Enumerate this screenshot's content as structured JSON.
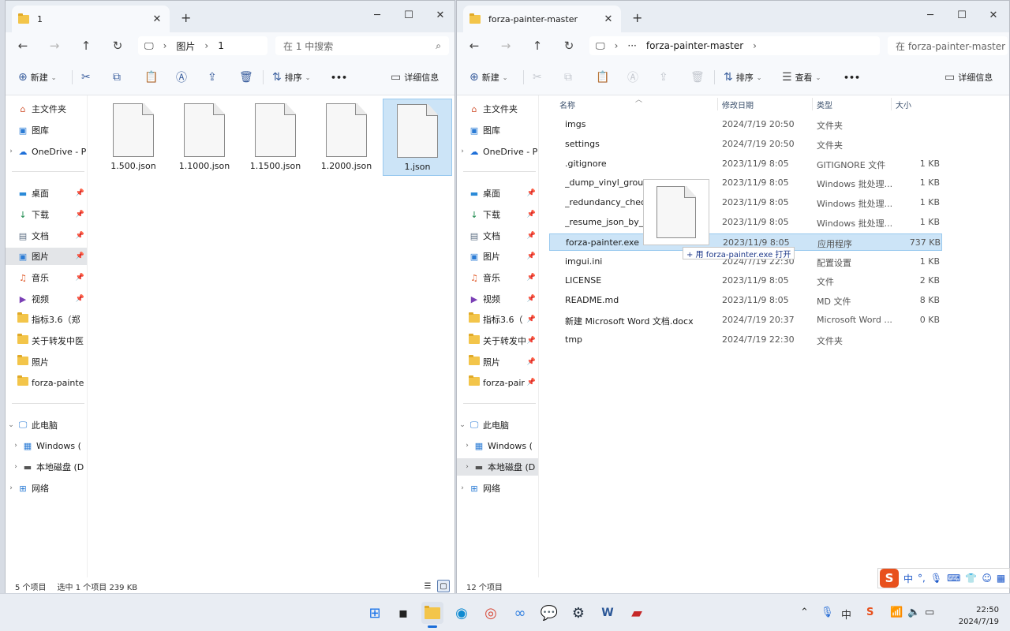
{
  "left_window": {
    "tab_title": "1",
    "address": {
      "root_label": "图片",
      "current": "1"
    },
    "search_placeholder": "在 1 中搜索",
    "toolbar": {
      "new_label": "新建",
      "sort_label": "排序",
      "details_label": "详细信息",
      "more_label": "•••"
    },
    "nav": {
      "home": "主文件夹",
      "gallery": "图库",
      "onedrive": "OneDrive - P",
      "quick": [
        {
          "label": "桌面",
          "icon": "desktop-icon"
        },
        {
          "label": "下载",
          "icon": "download-icon"
        },
        {
          "label": "文档",
          "icon": "document-icon"
        },
        {
          "label": "图片",
          "icon": "pictures-icon"
        },
        {
          "label": "音乐",
          "icon": "music-icon"
        },
        {
          "label": "视频",
          "icon": "video-icon"
        },
        {
          "label": "指标3.6（郑",
          "icon": "folder-icon"
        },
        {
          "label": "关于转发中医",
          "icon": "folder-icon"
        },
        {
          "label": "照片",
          "icon": "folder-icon"
        },
        {
          "label": "forza-painte",
          "icon": "folder-icon"
        }
      ],
      "this_pc": "此电脑",
      "drives": [
        "Windows (",
        "本地磁盘 (D"
      ],
      "network": "网络"
    },
    "files": [
      "1.500.json",
      "1.1000.json",
      "1.1500.json",
      "1.2000.json",
      "1.json"
    ],
    "selected_file": "1.json",
    "status": {
      "count": "5 个项目",
      "selection": "选中 1 个项目  239 KB"
    }
  },
  "right_window": {
    "tab_title": "forza-painter-master",
    "address": {
      "ellipsis": "···",
      "current": "forza-painter-master"
    },
    "search_placeholder": "在 forza-painter-master 中搜",
    "toolbar": {
      "new_label": "新建",
      "sort_label": "排序",
      "view_label": "查看",
      "details_label": "详细信息",
      "more_label": "•••"
    },
    "nav": {
      "home": "主文件夹",
      "gallery": "图库",
      "onedrive": "OneDrive - P",
      "quick": [
        {
          "label": "桌面",
          "icon": "desktop-icon"
        },
        {
          "label": "下载",
          "icon": "download-icon"
        },
        {
          "label": "文档",
          "icon": "document-icon"
        },
        {
          "label": "图片",
          "icon": "pictures-icon"
        },
        {
          "label": "音乐",
          "icon": "music-icon"
        },
        {
          "label": "视频",
          "icon": "video-icon"
        },
        {
          "label": "指标3.6（",
          "icon": "folder-icon"
        },
        {
          "label": "关于转发中",
          "icon": "folder-icon"
        },
        {
          "label": "照片",
          "icon": "folder-icon"
        },
        {
          "label": "forza-pair",
          "icon": "folder-icon"
        }
      ],
      "this_pc": "此电脑",
      "drives": [
        "Windows (",
        "本地磁盘 (D"
      ],
      "network": "网络"
    },
    "columns": {
      "name": "名称",
      "date": "修改日期",
      "type": "类型",
      "size": "大小"
    },
    "rows": [
      {
        "name": "imgs",
        "date": "2024/7/19 20:50",
        "type": "文件夹",
        "size": "",
        "icon": "folder"
      },
      {
        "name": "settings",
        "date": "2024/7/19 20:50",
        "type": "文件夹",
        "size": "",
        "icon": "folder"
      },
      {
        "name": ".gitignore",
        "date": "2023/11/9 8:05",
        "type": "GITIGNORE 文件",
        "size": "1 KB",
        "icon": "file"
      },
      {
        "name": "_dump_vinyl_group_",
        "date": "2023/11/9 8:05",
        "type": "Windows 批处理...",
        "size": "1 KB",
        "icon": "bat"
      },
      {
        "name": "_redundancy_check_",
        "date": "2023/11/9 8:05",
        "type": "Windows 批处理...",
        "size": "1 KB",
        "icon": "bat"
      },
      {
        "name": "_resume_json_by_dr",
        "date": "2023/11/9 8:05",
        "type": "Windows 批处理...",
        "size": "1 KB",
        "icon": "bat"
      },
      {
        "name": "forza-painter.exe",
        "date": "2023/11/9 8:05",
        "type": "应用程序",
        "size": "737 KB",
        "icon": "exe"
      },
      {
        "name": "imgui.ini",
        "date": "2024/7/19 22:30",
        "type": "配置设置",
        "size": "1 KB",
        "icon": "file"
      },
      {
        "name": "LICENSE",
        "date": "2023/11/9 8:05",
        "type": "文件",
        "size": "2 KB",
        "icon": "file"
      },
      {
        "name": "README.md",
        "date": "2023/11/9 8:05",
        "type": "MD 文件",
        "size": "8 KB",
        "icon": "file"
      },
      {
        "name": "新建 Microsoft Word 文档.docx",
        "date": "2024/7/19 20:37",
        "type": "Microsoft Word ...",
        "size": "0 KB",
        "icon": "word"
      },
      {
        "name": "tmp",
        "date": "2024/7/19 22:30",
        "type": "文件夹",
        "size": "",
        "icon": "folder"
      }
    ],
    "selected_row": "forza-painter.exe",
    "drag_tooltip": "+ 用 forza-painter.exe 打开",
    "status": {
      "count": "12 个项目"
    }
  },
  "ime_toolbar": {
    "mode": "中",
    "punct": "°,"
  },
  "taskbar": {
    "apps": [
      "start-icon",
      "terminal-icon",
      "file-explorer-icon",
      "edge-icon",
      "chrome-icon",
      "baidu-netdisk-icon",
      "wechat-icon",
      "steam-icon",
      "word-icon",
      "forza-icon"
    ],
    "clock_time": "22:50",
    "clock_date": "2024/7/19",
    "ime_indicator": "中"
  }
}
